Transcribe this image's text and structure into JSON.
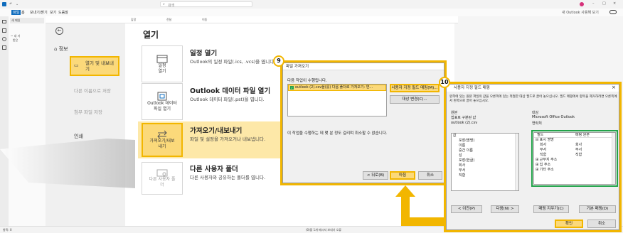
{
  "window": {
    "search_placeholder": "검색",
    "new_outlook_label": "새 Outlook 사용해 보기",
    "menu": [
      "파일",
      "홈",
      "보내기/받기",
      "보기",
      "도움말"
    ]
  },
  "ribbon": {
    "new_email": "새 메일",
    "items": [
      "답장",
      "전달",
      "이동"
    ]
  },
  "folder_pane": {
    "items": [
      "~ 내 기",
      "받은"
    ]
  },
  "backstage": {
    "title": "열기",
    "nav": {
      "info": "정보",
      "open_export": "열기 및 내보내기",
      "save_as": "다른 이름으로 저장",
      "save_attachments": "첨부 파일 저장",
      "print": "인쇄"
    },
    "cards": [
      {
        "btn": "일정\n열기",
        "title": "일정 열기",
        "desc": "Outlook의 일정 파일(.ics, .vcs)을 엽니다."
      },
      {
        "btn": "Outlook 데이터\n파일 열기",
        "title": "Outlook 데이터 파일 열기",
        "desc": "Outlook 데이터 파일(.pst)을 엽니다."
      },
      {
        "btn": "가져오기/내보\n내기",
        "title": "가져오기/내보내기",
        "desc": "파일 및 설정을 가져오거나 내보냅니다."
      },
      {
        "btn": "다른 사용자 폴\n더",
        "title": "다른 사용자 폴더",
        "desc": "다른 사용자와 공유하는 폴더를 엽니다."
      }
    ]
  },
  "import_dialog": {
    "title": "파일 가져오기",
    "prompt": "다음 작업이 수행됩니다.",
    "action_item": "outlook (2).csv을(를) 다음 폴더로 가져오기: 연...",
    "map_fields_button": "사용자 지정 필드 매핑(M)...",
    "change_dest_button": "대상 변경(C)...",
    "note": "이 작업을 수행하는 데 몇 분 정도 걸리며 취소할 수 없습니다.",
    "back_button": "< 뒤로(B)",
    "finish_button": "마침",
    "cancel_button": "취소",
    "badge": "9"
  },
  "map_dialog": {
    "title": "사용자 지정 필드 매핑",
    "close": "×",
    "instruction": "왼쪽에 있는 원본 파일의 값을 오른쪽에 있는 적절한 대상 필드로 끌어 놓으십시오. 필드 매핑에서 항목을 제거하려면 오른쪽에서 왼쪽으로 끌어 놓으십시오.",
    "from_label": "원본",
    "from_sub": "쉼표로 구분된 값",
    "from_file": "outlook (2).csv",
    "to_label": "대상",
    "to_sub": "Microsoft Office Outlook",
    "to_folder": "연락처",
    "source_header": "값",
    "source_items": [
      "포장(명명)",
      "이름",
      "중간 이름",
      "성",
      "포장(한글)",
      "회사",
      "부서",
      "직함"
    ],
    "target_headers": [
      "필드",
      "매핑 원본"
    ],
    "target_rows": [
      {
        "field": "⊟ 표시 명명",
        "mapped": ""
      },
      {
        "field": "회사",
        "mapped": "회사"
      },
      {
        "field": "부서",
        "mapped": "부서"
      },
      {
        "field": "직함",
        "mapped": "직함"
      },
      {
        "field": "⊞ 근무지 주소",
        "mapped": ""
      },
      {
        "field": "⊞ 집 주소",
        "mapped": ""
      },
      {
        "field": "⊞ 기타 주소",
        "mapped": ""
      }
    ],
    "prev_button": "< 이전(P)",
    "next_button": "다음(N) >",
    "clear_button": "매핑 지우기(C)",
    "default_button": "기본 매핑(D)",
    "ok_button": "확인",
    "cancel_button": "취소",
    "badge": "10"
  },
  "statusbar": {
    "left": "항목: 0",
    "center": "(0)을 1개 메시지 보내기 오류"
  },
  "colors": {
    "highlight": "#f2b600",
    "green": "#22a34a",
    "accent": "#0078d7"
  }
}
